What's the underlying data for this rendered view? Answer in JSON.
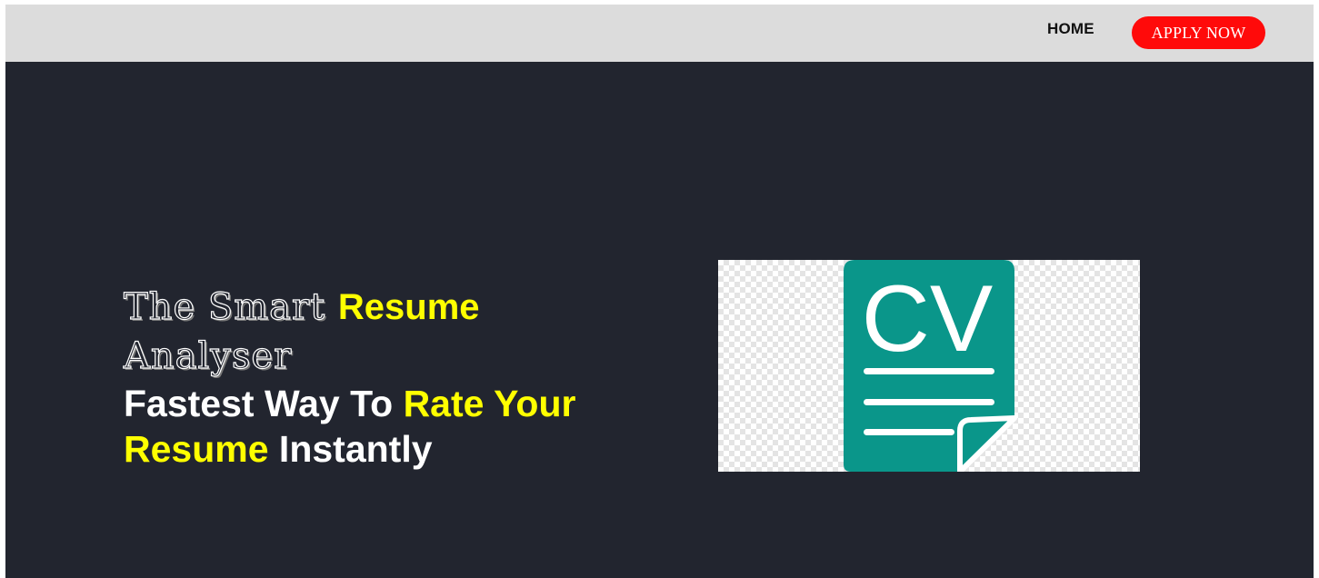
{
  "nav": {
    "home_label": "HOME",
    "apply_label": "APPLY NOW"
  },
  "hero": {
    "title_plain": "The Smart",
    "title_highlight": "Resume",
    "title_line2": "Analyser",
    "tagline_part1": "Fastest Way To",
    "tagline_highlight1": "Rate Your",
    "tagline_highlight2": "Resume",
    "tagline_part2": "Instantly"
  },
  "cv_icon": {
    "label": "CV",
    "icon": "cv-document-icon"
  },
  "colors": {
    "background": "#22252f",
    "navbar": "#dcdcdc",
    "accent_red": "#ff0a0a",
    "highlight_yellow": "#ffff00",
    "icon_teal": "#0a968a"
  }
}
